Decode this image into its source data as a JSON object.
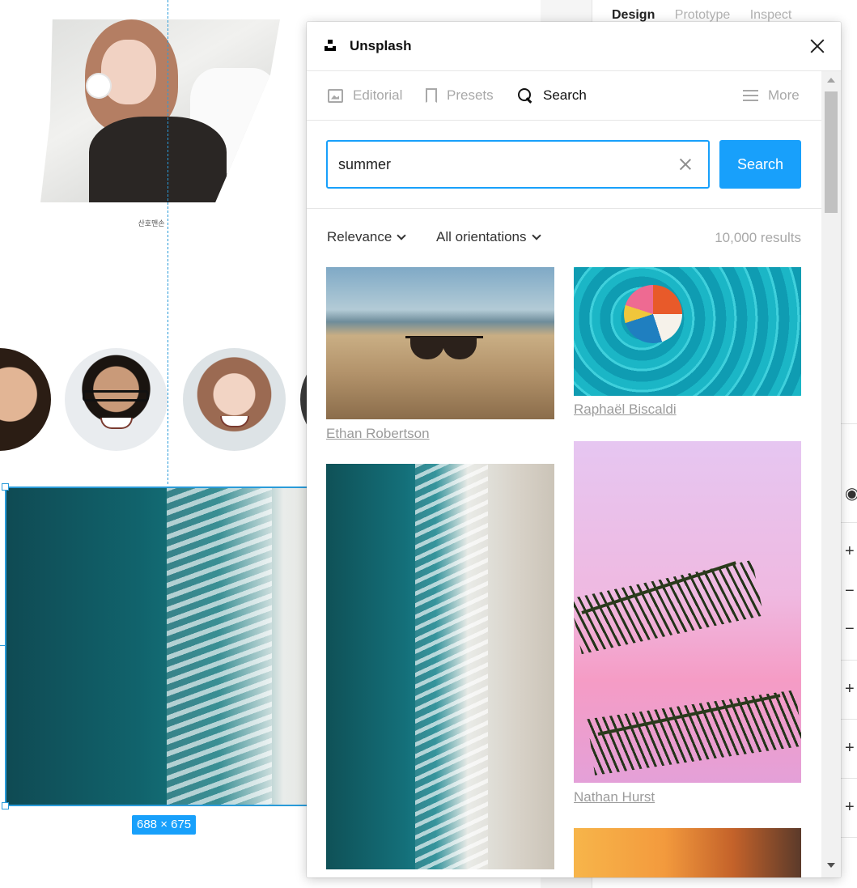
{
  "canvas": {
    "caption": "산호맨손",
    "dimension_badge": "688 × 675"
  },
  "design_panel": {
    "tabs": [
      "Design",
      "Prototype",
      "Inspect"
    ],
    "active_tab": "Design"
  },
  "plugin": {
    "title": "Unsplash",
    "nav": {
      "editorial": "Editorial",
      "presets": "Presets",
      "search": "Search",
      "more": "More"
    },
    "search": {
      "value": "summer",
      "button": "Search"
    },
    "filters": {
      "sort": "Relevance",
      "orientation": "All orientations",
      "results": "10,000 results"
    },
    "photos": [
      {
        "subject": "sunglasses on beach sand",
        "credit": "Ethan Robertson"
      },
      {
        "subject": "beach ball in pool",
        "credit": "Raphaël Biscaldi"
      },
      {
        "subject": "aerial ocean shoreline",
        "credit": ""
      },
      {
        "subject": "palm leaves on pink sky",
        "credit": "Nathan Hurst"
      },
      {
        "subject": "sunset",
        "credit": ""
      }
    ]
  },
  "colors": {
    "accent": "#18a0fb",
    "selection": "#2a9bd9"
  }
}
